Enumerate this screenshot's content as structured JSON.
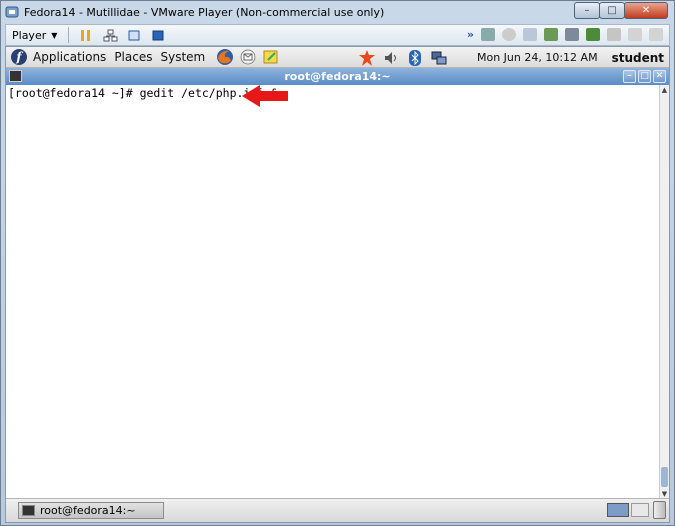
{
  "window": {
    "title": "Fedora14 - Mutillidae - VMware Player (Non-commercial use only)"
  },
  "toolbar": {
    "player_label": "Player"
  },
  "gnome_panel": {
    "menus": [
      "Applications",
      "Places",
      "System"
    ],
    "clock": "Mon Jun 24, 10:12 AM",
    "user": "student"
  },
  "terminal": {
    "title": "root@fedora14:~",
    "prompt": "[root@fedora14 ~]# ",
    "command": "gedit /etc/php.ini &"
  },
  "taskbar": {
    "task_label": "root@fedora14:~"
  },
  "colors": {
    "annotation_arrow": "#e81818",
    "title_bar": "#5a8cc8"
  },
  "icons": [
    "vmware-icon",
    "pause-icon",
    "network-icon",
    "fullscreen-icon",
    "unity-icon",
    "firefox-icon",
    "email-icon",
    "notes-icon",
    "update-alert-icon",
    "volume-icon",
    "bluetooth-icon",
    "network-manager-icon",
    "trash-icon"
  ]
}
